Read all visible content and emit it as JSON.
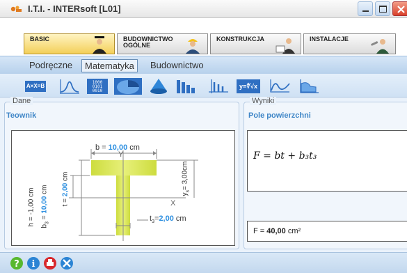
{
  "window": {
    "title": "I.T.I. - INTERsoft [L01]"
  },
  "main_tabs": [
    {
      "label": "BASIC",
      "active": true
    },
    {
      "label": "BUDOWNICTWO\nOGÓLNE",
      "active": false
    },
    {
      "label": "KONSTRUKCJA",
      "active": false
    },
    {
      "label": "INSTALACJE",
      "active": false
    }
  ],
  "sub_tabs": [
    {
      "label": "Podręczne",
      "active": false
    },
    {
      "label": "Matematyka",
      "active": true
    },
    {
      "label": "Budownictwo",
      "active": false
    }
  ],
  "toolbar": {
    "first_tool_text": "A×X=B",
    "sqrt_tool_text": "y=∜√x",
    "tools": [
      "equation-tool",
      "gauss-curve-tool",
      "binary-tool",
      "pie-tool",
      "cone-tool",
      "bars-tool",
      "axis-chart-tool",
      "root-tool",
      "function-tool",
      "area-chart-tool"
    ]
  },
  "left_panel": {
    "legend": "Dane",
    "title": "Teownik",
    "drawing": {
      "b_label": "b = ",
      "b_value": "10,00",
      "b_unit": "cm",
      "Y": "Y",
      "X": "X",
      "h_label": "h = -1,00 cm",
      "b3_label": "b",
      "b3_sub": "3",
      "b3_eq": " = ",
      "b3_value": "10,00",
      "b3_unit": " cm",
      "t_label": "t = ",
      "t_value": "2,00",
      "t_unit": " cm",
      "ys_label": "y",
      "ys_sub": "s",
      "ys_value": "= 3,00cm",
      "t3_label": "t",
      "t3_sub": "3",
      "t3_eq": "=",
      "t3_value": "2,00",
      "t3_unit": " cm"
    }
  },
  "right_panel": {
    "legend": "Wyniki",
    "title": "Pole powierzchni",
    "formula": "F = bt + b₃t₃",
    "result_prefix": "F = ",
    "result_value": "40,00",
    "result_unit": " cm²"
  },
  "bottom_icons": [
    "help-icon",
    "info-icon",
    "print-icon",
    "tools-icon"
  ],
  "colors": {
    "accent_blue": "#3f86c7",
    "tee_fill": "#d6e94a",
    "value_blue": "#2d8fe0",
    "basic_tab_yellow": "#f3cf59"
  }
}
